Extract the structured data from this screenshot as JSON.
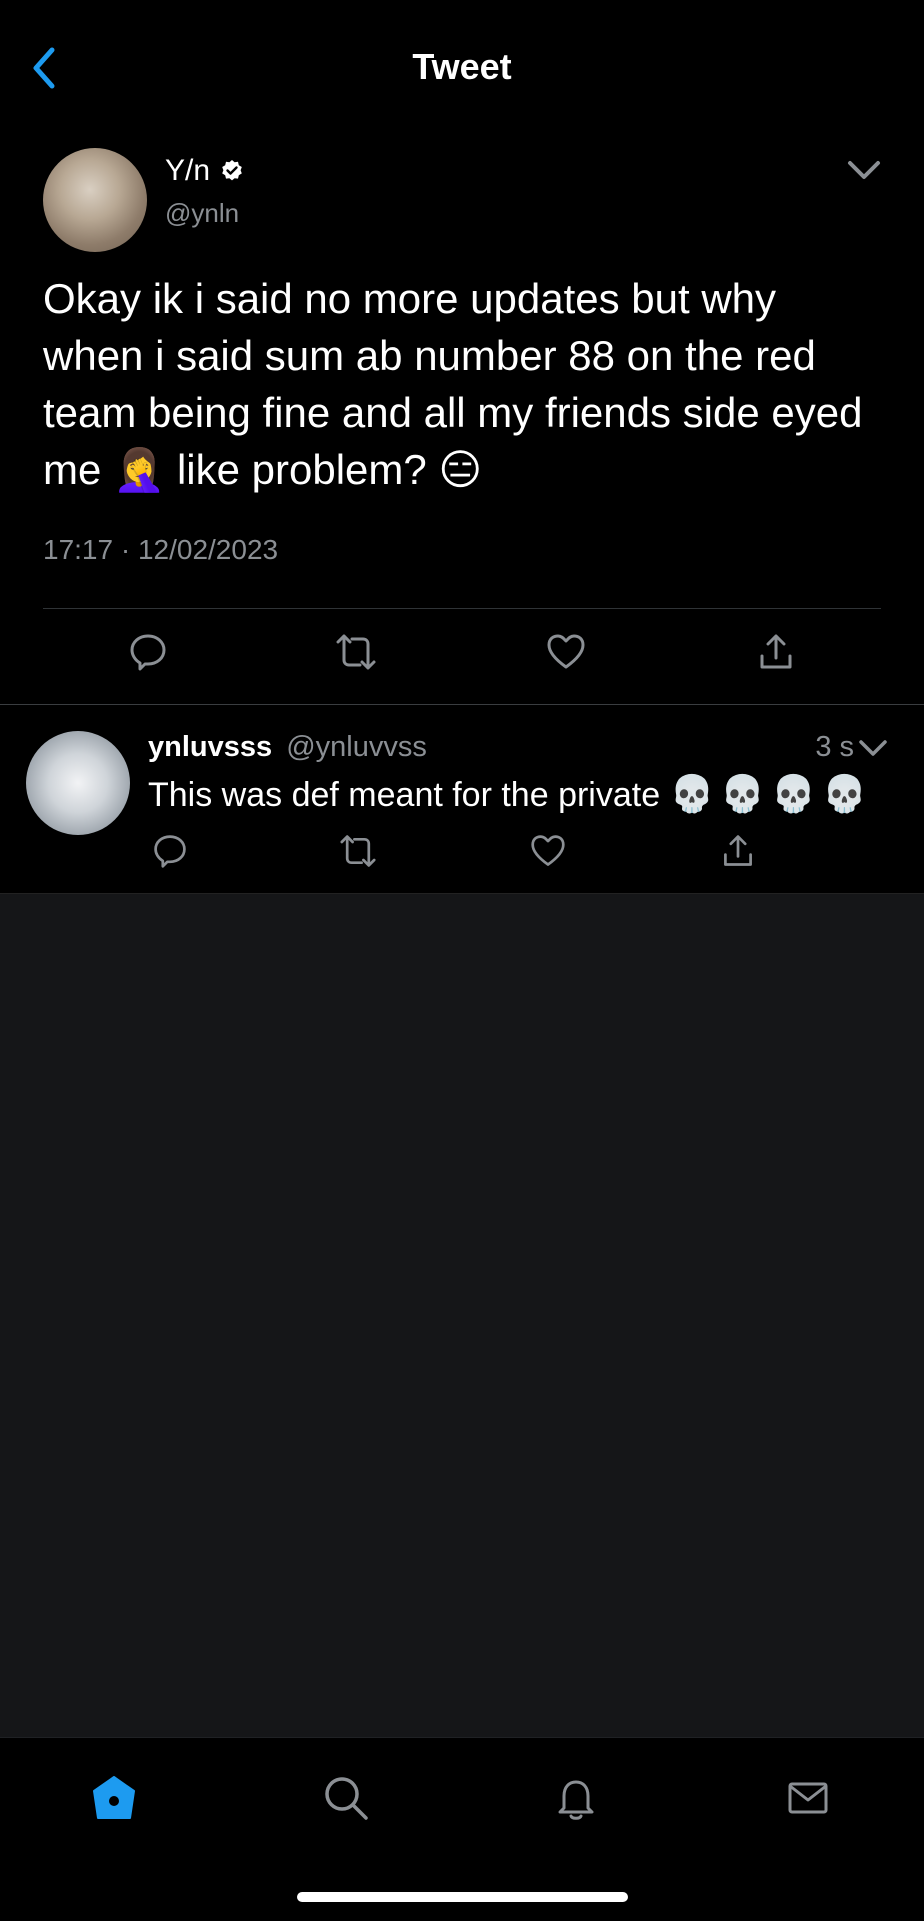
{
  "header": {
    "title": "Tweet",
    "back_icon": "chevron-left-icon"
  },
  "colors": {
    "accent": "#1d9bf0",
    "muted": "#8b8f94",
    "background": "#000000",
    "empty": "#151618"
  },
  "tweet": {
    "author_name": "Y/n",
    "author_handle": "@ynln",
    "verified": true,
    "text": "Okay ik i said no more updates but why when i said sum ab number 88 on the red team being fine and all my friends side eyed me 🤦‍♀️ like problem? 😑",
    "timestamp": "17:17 · 12/02/2023",
    "actions": [
      "reply-icon",
      "retweet-icon",
      "like-icon",
      "share-icon"
    ]
  },
  "reply": {
    "author_name": "ynluvsss",
    "author_handle": "@ynluvvss",
    "time": "3 s",
    "text": "This was def meant for the private",
    "emoji": "💀💀💀💀",
    "actions": [
      "reply-icon",
      "retweet-icon",
      "like-icon",
      "share-icon"
    ]
  },
  "tabbar": {
    "items": [
      "home-icon",
      "search-icon",
      "notifications-icon",
      "messages-icon"
    ],
    "active": "home-icon"
  }
}
